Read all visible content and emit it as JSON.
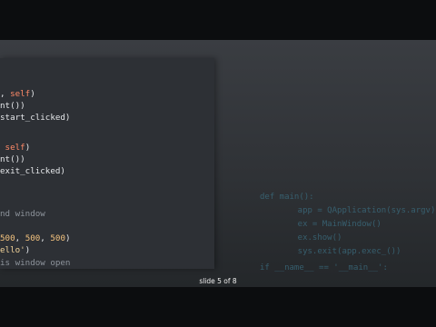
{
  "editor": {
    "lines": [
      {
        "segments": [
          {
            "t": ", ",
            "c": ""
          },
          {
            "t": "self",
            "c": "kw"
          },
          {
            "t": ")",
            "c": ""
          }
        ]
      },
      {
        "segments": [
          {
            "t": "nt())",
            "c": ""
          }
        ]
      },
      {
        "segments": [
          {
            "t": "start_clicked)",
            "c": ""
          }
        ]
      },
      {
        "segments": [
          {
            "t": " ",
            "c": ""
          },
          {
            "t": "self",
            "c": "kw"
          },
          {
            "t": ")",
            "c": ""
          }
        ]
      },
      {
        "segments": [
          {
            "t": "nt())",
            "c": ""
          }
        ]
      },
      {
        "segments": [
          {
            "t": "exit_clicked)",
            "c": ""
          }
        ]
      },
      {
        "segments": [
          {
            "t": "nd window",
            "c": "cm"
          }
        ]
      },
      {
        "segments": [
          {
            "t": "500",
            "c": "num"
          },
          {
            "t": ", ",
            "c": ""
          },
          {
            "t": "500",
            "c": "num"
          },
          {
            "t": ", ",
            "c": ""
          },
          {
            "t": "500",
            "c": "num"
          },
          {
            "t": ")",
            "c": ""
          }
        ]
      },
      {
        "segments": [
          {
            "t": "ello'",
            "c": "str"
          },
          {
            "t": ")",
            "c": ""
          }
        ]
      },
      {
        "segments": [
          {
            "t": "is window open",
            "c": "cm"
          }
        ]
      }
    ]
  },
  "background_code": [
    "def main():",
    "    app = QApplication(sys.argv)",
    "    ex = MainWindow()",
    "    ex.show()",
    "    sys.exit(app.exec_())",
    "if __name__ == '__main__':"
  ],
  "footer": {
    "slide_counter": "slide 5 of 8"
  }
}
